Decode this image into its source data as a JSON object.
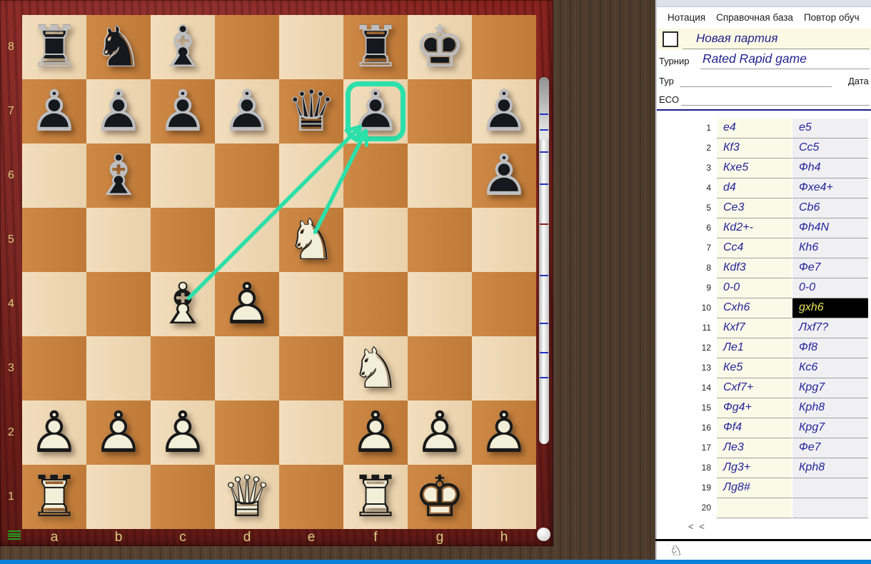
{
  "board": {
    "files": [
      "a",
      "b",
      "c",
      "d",
      "e",
      "f",
      "g",
      "h"
    ],
    "ranks": [
      "8",
      "7",
      "6",
      "5",
      "4",
      "3",
      "2",
      "1"
    ],
    "pieces": [
      {
        "square": "a8",
        "color": "black",
        "type": "rook"
      },
      {
        "square": "b8",
        "color": "black",
        "type": "knight"
      },
      {
        "square": "c8",
        "color": "black",
        "type": "bishop"
      },
      {
        "square": "f8",
        "color": "black",
        "type": "rook"
      },
      {
        "square": "g8",
        "color": "black",
        "type": "king"
      },
      {
        "square": "a7",
        "color": "black",
        "type": "pawn"
      },
      {
        "square": "b7",
        "color": "black",
        "type": "pawn"
      },
      {
        "square": "c7",
        "color": "black",
        "type": "pawn"
      },
      {
        "square": "d7",
        "color": "black",
        "type": "pawn"
      },
      {
        "square": "e7",
        "color": "black",
        "type": "queen"
      },
      {
        "square": "f7",
        "color": "black",
        "type": "pawn"
      },
      {
        "square": "h7",
        "color": "black",
        "type": "pawn"
      },
      {
        "square": "b6",
        "color": "black",
        "type": "bishop"
      },
      {
        "square": "h6",
        "color": "black",
        "type": "pawn"
      },
      {
        "square": "e5",
        "color": "white",
        "type": "knight"
      },
      {
        "square": "c4",
        "color": "white",
        "type": "bishop"
      },
      {
        "square": "d4",
        "color": "white",
        "type": "pawn"
      },
      {
        "square": "f3",
        "color": "white",
        "type": "knight"
      },
      {
        "square": "a2",
        "color": "white",
        "type": "pawn"
      },
      {
        "square": "b2",
        "color": "white",
        "type": "pawn"
      },
      {
        "square": "c2",
        "color": "white",
        "type": "pawn"
      },
      {
        "square": "f2",
        "color": "white",
        "type": "pawn"
      },
      {
        "square": "g2",
        "color": "white",
        "type": "pawn"
      },
      {
        "square": "h2",
        "color": "white",
        "type": "pawn"
      },
      {
        "square": "a1",
        "color": "white",
        "type": "rook"
      },
      {
        "square": "d1",
        "color": "white",
        "type": "queen"
      },
      {
        "square": "f1",
        "color": "white",
        "type": "rook"
      },
      {
        "square": "g1",
        "color": "white",
        "type": "king"
      }
    ],
    "glyphs": {
      "filled": {
        "king": "♚",
        "queen": "♛",
        "rook": "♜",
        "bishop": "♝",
        "knight": "♞",
        "pawn": "♟"
      },
      "hollow": {
        "king": "♔",
        "queen": "♕",
        "rook": "♖",
        "bishop": "♗",
        "knight": "♘",
        "pawn": "♙"
      }
    },
    "highlight_square": "f7",
    "arrows": [
      {
        "from": "c4",
        "to": "f7"
      },
      {
        "from": "e5",
        "to": "f7"
      }
    ],
    "slider_ticks": {
      "blue": [
        159,
        181,
        212,
        257,
        385,
        452,
        493,
        528
      ],
      "red": [
        313
      ]
    },
    "colors": {
      "light_square": "#f0dcba",
      "dark_square": "#c8823f",
      "frame": "#7d201c",
      "coords": "#dbcd80",
      "arrow": "#2be0aa",
      "highlight": "#2be0aa",
      "taskbar": "#0b80d7"
    }
  },
  "panel": {
    "tabs": [
      {
        "label": "Нотация"
      },
      {
        "label": "Справочная база"
      },
      {
        "label": "Повтор обуч"
      }
    ],
    "header": {
      "new_game_label": "Новая партия",
      "tournament_label": "Турнир",
      "tournament_value": "Rated Rapid game",
      "round_label": "Тур",
      "round_value": "",
      "date_label": "Дата",
      "date_value": "",
      "eco_label": "ECO",
      "eco_value": ""
    },
    "moves": [
      {
        "n": "1",
        "w": "e4",
        "b": "e5"
      },
      {
        "n": "2",
        "w": "Кf3",
        "b": "Сc5"
      },
      {
        "n": "3",
        "w": "Кxe5",
        "b": "Фh4"
      },
      {
        "n": "4",
        "w": "d4",
        "b": "Фxe4+"
      },
      {
        "n": "5",
        "w": "Сe3",
        "b": "Сb6"
      },
      {
        "n": "6",
        "w": "Кd2+-",
        "b": "Фh4N"
      },
      {
        "n": "7",
        "w": "Сc4",
        "b": "Кh6"
      },
      {
        "n": "8",
        "w": "Кdf3",
        "b": "Фe7"
      },
      {
        "n": "9",
        "w": "0-0",
        "b": "0-0"
      },
      {
        "n": "10",
        "w": "Сxh6",
        "b": "gxh6"
      },
      {
        "n": "11",
        "w": "Кxf7",
        "b": "Лxf7?"
      },
      {
        "n": "12",
        "w": "Ле1",
        "b": "Фf8"
      },
      {
        "n": "13",
        "w": "Кe5",
        "b": "Кc6"
      },
      {
        "n": "14",
        "w": "Сxf7+",
        "b": "Крg7"
      },
      {
        "n": "15",
        "w": "Фg4+",
        "b": "Крh8"
      },
      {
        "n": "16",
        "w": "Фf4",
        "b": "Крg7"
      },
      {
        "n": "17",
        "w": "Ле3",
        "b": "Фe7"
      },
      {
        "n": "18",
        "w": "Лg3+",
        "b": "Крh8"
      },
      {
        "n": "19",
        "w": "Лg8#",
        "b": ""
      },
      {
        "n": "20",
        "w": "",
        "b": ""
      }
    ],
    "highlight": {
      "move_number": "10",
      "side": "black",
      "text": "gxh6"
    },
    "pager_label": "< <"
  },
  "statusbar": {
    "knight_glyph": "♘"
  }
}
